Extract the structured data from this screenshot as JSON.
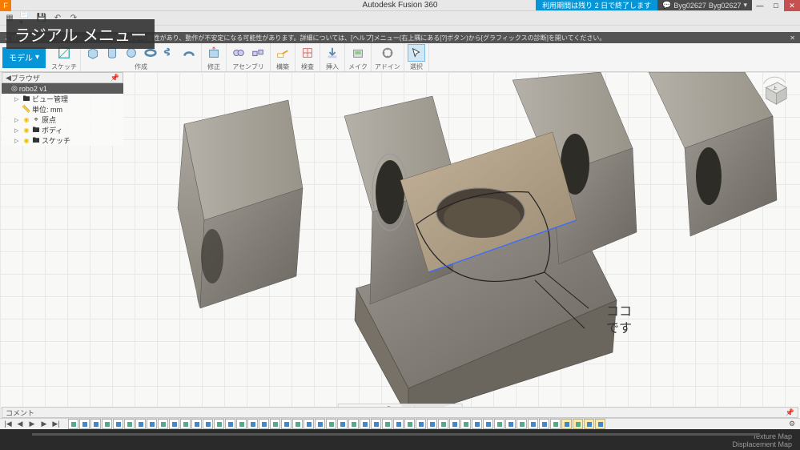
{
  "title": "Autodesk Fusion 360",
  "trial_notice": "利用期間は残り 2 日で終了します",
  "user": {
    "name1": "Byg02627",
    "name2": "Byg02627"
  },
  "window_controls": {
    "min": "—",
    "max": "□",
    "close": "✕"
  },
  "tooltip": {
    "title": "ラジアル メニュー"
  },
  "notification": "ご使用のグラフィックス ドライバは最新でない可能性があり、動作が不安定になる可能性があります。詳細については、[ヘルプ]メニュー(右上隅にある[?]ボタン)から[グラフィックスの診断]を開いてください。",
  "ribbon": {
    "model": "モデル",
    "groups": [
      {
        "label": "スケッチ"
      },
      {
        "label": "作成"
      },
      {
        "label": "修正"
      },
      {
        "label": "アセンブリ"
      },
      {
        "label": "構築"
      },
      {
        "label": "検査"
      },
      {
        "label": "挿入"
      },
      {
        "label": "メイク"
      },
      {
        "label": "アドイン"
      },
      {
        "label": "選択"
      }
    ]
  },
  "browser": {
    "header": "ブラウザ",
    "root": "robo2 v1",
    "items": [
      {
        "label": "ビュー管理"
      },
      {
        "label": "単位: mm"
      },
      {
        "label": "原点"
      },
      {
        "label": "ボディ"
      },
      {
        "label": "スケッチ"
      }
    ]
  },
  "annotation": {
    "line1": "ココ",
    "line2": "です"
  },
  "viewcube_face": "上",
  "comments": {
    "label": "コメント"
  },
  "timeline": {
    "controls": {
      "first": "|◀",
      "prev": "◀",
      "play": "▶",
      "next": "▶",
      "last": "▶|"
    },
    "setting": "⚙"
  },
  "footer": {
    "line1": "Texture Map",
    "line2": "Displacement Map"
  }
}
